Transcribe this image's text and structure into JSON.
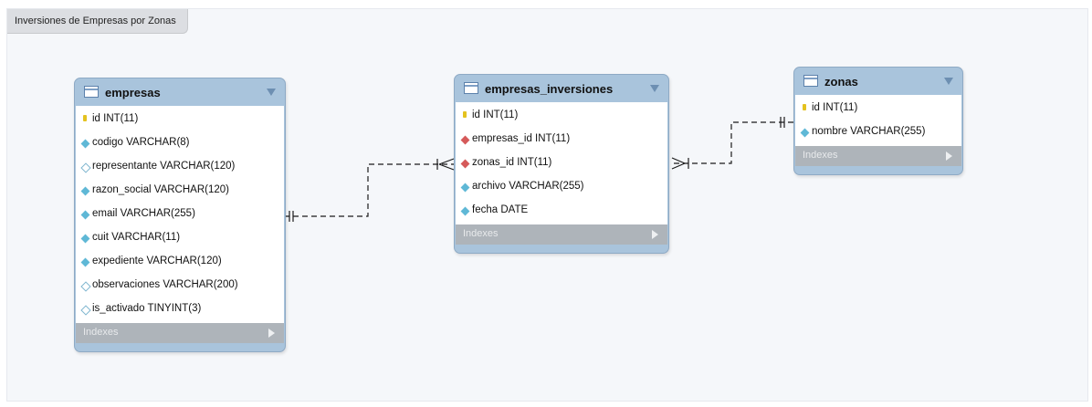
{
  "diagram": {
    "title": "Inversiones de Empresas por Zonas",
    "tables": {
      "empresas": {
        "name": "empresas",
        "columns": [
          {
            "label": "id INT(11)",
            "kind": "primary-key"
          },
          {
            "label": "codigo VARCHAR(8)",
            "kind": "attribute"
          },
          {
            "label": "representante VARCHAR(120)",
            "kind": "nullable"
          },
          {
            "label": "razon_social VARCHAR(120)",
            "kind": "attribute"
          },
          {
            "label": "email VARCHAR(255)",
            "kind": "attribute"
          },
          {
            "label": "cuit VARCHAR(11)",
            "kind": "attribute"
          },
          {
            "label": "expediente VARCHAR(120)",
            "kind": "attribute"
          },
          {
            "label": "observaciones VARCHAR(200)",
            "kind": "nullable"
          },
          {
            "label": "is_activado TINYINT(3)",
            "kind": "nullable"
          }
        ],
        "indexes_label": "Indexes"
      },
      "empresas_inversiones": {
        "name": "empresas_inversiones",
        "columns": [
          {
            "label": "id INT(11)",
            "kind": "primary-key"
          },
          {
            "label": "empresas_id INT(11)",
            "kind": "foreign-key"
          },
          {
            "label": "zonas_id INT(11)",
            "kind": "foreign-key"
          },
          {
            "label": "archivo VARCHAR(255)",
            "kind": "attribute"
          },
          {
            "label": "fecha DATE",
            "kind": "attribute"
          }
        ],
        "indexes_label": "Indexes"
      },
      "zonas": {
        "name": "zonas",
        "columns": [
          {
            "label": "id INT(11)",
            "kind": "primary-key"
          },
          {
            "label": "nombre VARCHAR(255)",
            "kind": "attribute"
          }
        ],
        "indexes_label": "Indexes"
      }
    },
    "relations": [
      {
        "from": "empresas",
        "to": "empresas_inversiones",
        "style": "dashed",
        "from_end": "one-mandatory",
        "to_end": "many-optional"
      },
      {
        "from": "zonas",
        "to": "empresas_inversiones",
        "style": "dashed",
        "from_end": "one-mandatory",
        "to_end": "many-mandatory"
      }
    ],
    "colors": {
      "entity_header": "#a9c4dc",
      "indexes_bar": "#aeb4ba",
      "canvas": "#f5f7fa",
      "primary_key": "#e4c21f",
      "foreign_key": "#d55a5a",
      "attribute": "#5fb8d6"
    }
  }
}
